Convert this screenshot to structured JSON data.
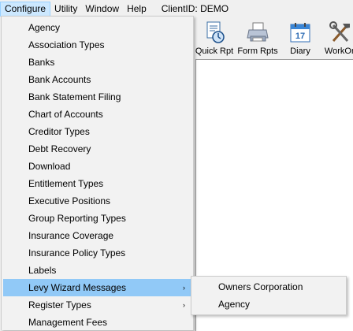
{
  "menubar": {
    "items": [
      "Configure",
      "Utility",
      "Window",
      "Help"
    ],
    "client": "ClientID: DEMO"
  },
  "toolbar": {
    "buttons": [
      {
        "label": "Quick Rpt",
        "icon": "quick-report-icon"
      },
      {
        "label": "Form Rpts",
        "icon": "printer-icon"
      },
      {
        "label": "Diary",
        "icon": "calendar-icon"
      },
      {
        "label": "WorkOn",
        "icon": "tools-icon"
      }
    ]
  },
  "configure_menu": {
    "items": [
      "Agency",
      "Association Types",
      "Banks",
      "Bank Accounts",
      "Bank Statement Filing",
      "Chart of Accounts",
      "Creditor Types",
      "Debt Recovery",
      "Download",
      "Entitlement Types",
      "Executive Positions",
      "Group Reporting Types",
      "Insurance Coverage",
      "Insurance Policy Types",
      "Labels",
      "Levy Wizard Messages",
      "Register Types",
      "Management Fees"
    ],
    "highlighted": "Levy Wizard Messages",
    "submenu_arrow": "›"
  },
  "levy_submenu": {
    "items": [
      "Owners Corporation",
      "Agency"
    ]
  },
  "colors": {
    "menu_highlight": "#91c9f7",
    "menubar_active": "#cce8ff"
  }
}
